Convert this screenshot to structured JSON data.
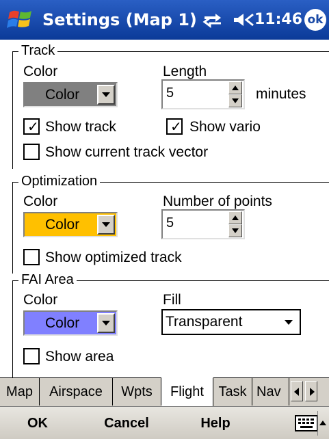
{
  "title_bar": {
    "title": "Settings (Map 1)",
    "clock": "11:46",
    "ok_label": "ok",
    "icons": [
      "windows-start-icon",
      "connectivity-icon",
      "volume-icon"
    ]
  },
  "groups": {
    "track": {
      "legend": "Track",
      "color_label": "Color",
      "color_button_label": "Color",
      "color_swatch": "#808080",
      "length_label": "Length",
      "length_value": "5",
      "length_unit": "minutes",
      "show_track_label": "Show track",
      "show_track_checked": true,
      "show_vario_label": "Show vario",
      "show_vario_checked": true,
      "show_vector_label": "Show current track vector",
      "show_vector_checked": false
    },
    "optimization": {
      "legend": "Optimization",
      "color_label": "Color",
      "color_button_label": "Color",
      "color_swatch": "#ffc000",
      "points_label": "Number of points",
      "points_value": "5",
      "show_optimized_label": "Show optimized track",
      "show_optimized_checked": false
    },
    "fai": {
      "legend": "FAI Area",
      "color_label": "Color",
      "color_button_label": "Color",
      "color_swatch": "#8080ff",
      "fill_label": "Fill",
      "fill_value": "Transparent",
      "show_area_label": "Show area",
      "show_area_checked": false
    }
  },
  "tabs": [
    {
      "label": "Map",
      "active": false
    },
    {
      "label": "Airspace",
      "active": false
    },
    {
      "label": "Wpts",
      "active": false
    },
    {
      "label": "Flight",
      "active": true
    },
    {
      "label": "Task",
      "active": false
    },
    {
      "label": "Nav",
      "active": false
    }
  ],
  "menu": {
    "ok": "OK",
    "cancel": "Cancel",
    "help": "Help"
  },
  "colors": {
    "titlebar": "#1a4aa6",
    "chrome": "#d4d0c8"
  }
}
